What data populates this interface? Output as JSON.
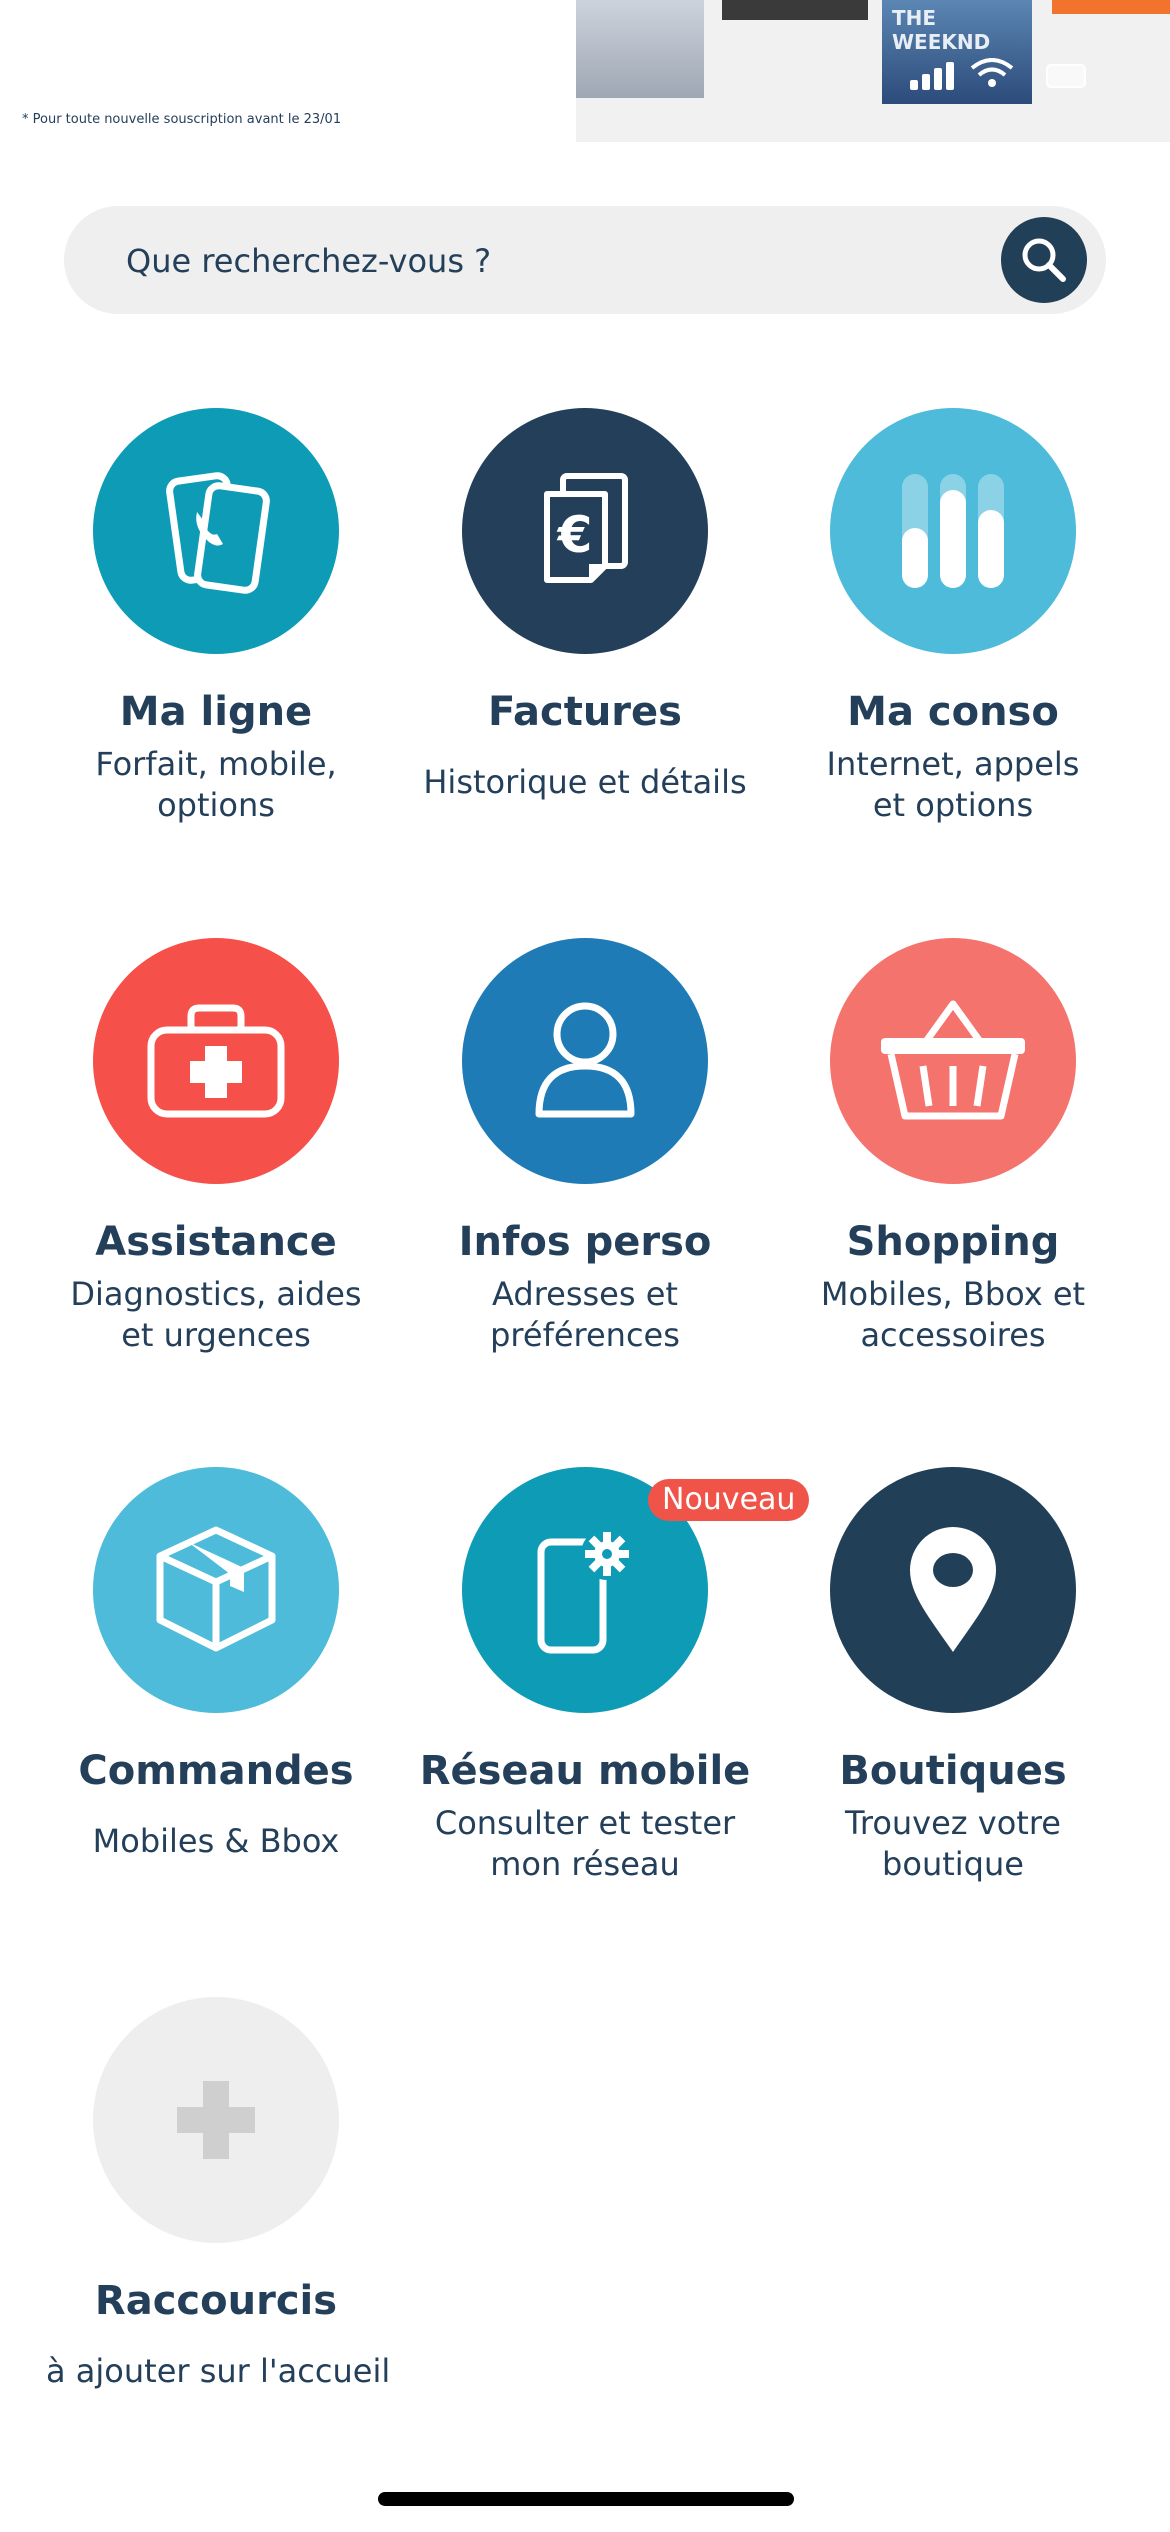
{
  "banner": {
    "footnote": "* Pour toute nouvelle souscription avant le 23/01",
    "magazine_title": "THE WEEKND"
  },
  "search": {
    "placeholder": "Que recherchez-vous ?",
    "icon": "search-icon"
  },
  "tiles": [
    {
      "title": "Ma ligne",
      "subtitle": "Forfait, mobile,\noptions",
      "color": "#0e9bb5",
      "icon": "phones-icon"
    },
    {
      "title": "Factures",
      "subtitle": "Historique et détails",
      "color": "#243f5a",
      "icon": "invoice-euro-icon"
    },
    {
      "title": "Ma conso",
      "subtitle": "Internet, appels\net options",
      "color": "#4dbbd9",
      "icon": "usage-bars-icon"
    },
    {
      "title": "Assistance",
      "subtitle": "Diagnostics, aides\net urgences",
      "color": "#f5504a",
      "icon": "first-aid-kit-icon"
    },
    {
      "title": "Infos perso",
      "subtitle": "Adresses et\npréférences",
      "color": "#1f7bb5",
      "icon": "user-icon"
    },
    {
      "title": "Shopping",
      "subtitle": "Mobiles, Bbox et\naccessoires",
      "color": "#f4736d",
      "icon": "shopping-basket-icon"
    },
    {
      "title": "Commandes",
      "subtitle": "Mobiles & Bbox",
      "color": "#4dbbd9",
      "icon": "package-box-icon"
    },
    {
      "title": "Réseau mobile",
      "subtitle": "Consulter et tester\nmon réseau",
      "color": "#0e9bb5",
      "icon": "phone-gear-icon",
      "badge": "Nouveau"
    },
    {
      "title": "Boutiques",
      "subtitle": "Trouvez votre\nboutique",
      "color": "#223f58",
      "icon": "location-pin-icon"
    },
    {
      "title": "Raccourcis",
      "subtitle": "à ajouter sur l'accueil",
      "color": "#eeeeee",
      "icon": "plus-icon"
    }
  ]
}
